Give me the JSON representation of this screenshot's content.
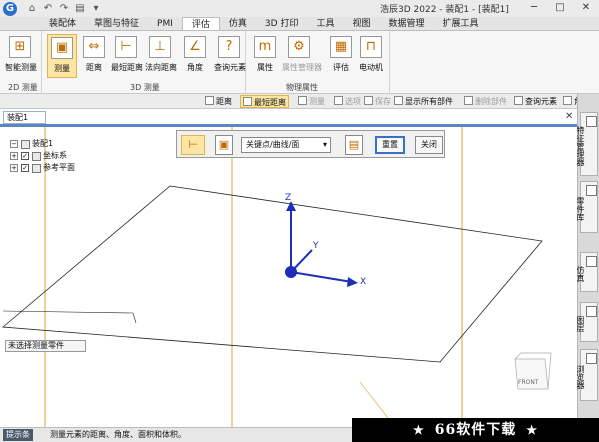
{
  "titlebar": {
    "title": "浩辰3D 2022 - 装配1 - [装配1]",
    "quick_access": [
      "⌂",
      "↶",
      "↷",
      "▤",
      "▾"
    ],
    "window_controls": [
      "─",
      "□",
      "✕"
    ]
  },
  "menu": {
    "tabs": [
      "装配体",
      "草图与特征",
      "PMI",
      "评估",
      "仿真",
      "3D 打印",
      "工具",
      "视图",
      "数据管理",
      "扩展工具"
    ]
  },
  "ribbon": {
    "groups": [
      {
        "caption": "2D 测量",
        "buttons": [
          "智能测量"
        ]
      },
      {
        "caption": "3D 测量",
        "buttons": [
          "测量",
          "距离",
          "最短距离",
          "法向距离",
          "角度",
          "查询元素"
        ]
      },
      {
        "caption": "物理属性",
        "buttons": [
          "属性",
          "属性管理器",
          "评估",
          "电动机"
        ]
      }
    ]
  },
  "toolbar2": {
    "items": [
      "距离",
      "最短距离",
      "测量",
      "选项",
      "保存",
      "显示所有部件",
      "删除部件",
      "查询元素",
      "角度"
    ]
  },
  "document": {
    "tab": "装配1",
    "close": "✕"
  },
  "tree": {
    "root": "装配1",
    "children": [
      "坐标系",
      "参考平面"
    ]
  },
  "floatbar": {
    "mode": "关键点/曲线/面",
    "reset": "重置",
    "close": "关闭"
  },
  "viewport": {
    "axes": [
      "Z",
      "Y",
      "X"
    ],
    "view_cube": "FRONT",
    "hint": "未选择测量零件"
  },
  "rightpanel": {
    "items": [
      "特征管理器",
      "零件库",
      "仿真",
      "图层",
      "浏览器"
    ]
  },
  "status": {
    "label": "提示条",
    "text": "测量元素的距离、角度、面积和体积。"
  },
  "promo": {
    "text": "66软件下载",
    "star": "★"
  },
  "colors": {
    "accent_selected": "#fbe6a6",
    "doc_bar": "#5b86c4",
    "frame_orange": "#e8c27a",
    "axis_blue": "#1d2fb8"
  }
}
